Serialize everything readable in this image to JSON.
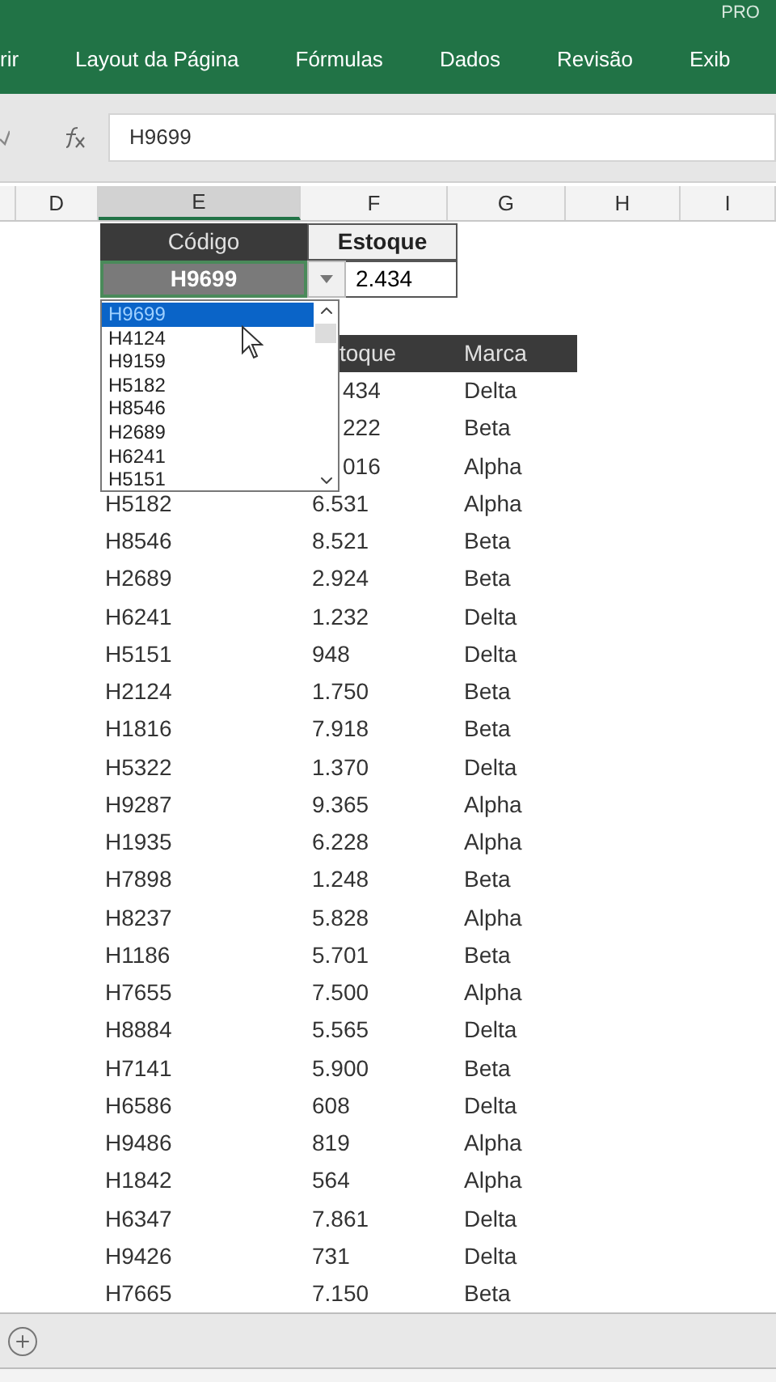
{
  "title": "PRO",
  "ribbon_tabs": [
    "rir",
    "Layout da Página",
    "Fórmulas",
    "Dados",
    "Revisão",
    "Exib"
  ],
  "formula_bar": {
    "value": "H9699"
  },
  "column_headers": [
    {
      "label": "D",
      "selected": false
    },
    {
      "label": "E",
      "selected": true
    },
    {
      "label": "F",
      "selected": false
    },
    {
      "label": "G",
      "selected": false
    },
    {
      "label": "H",
      "selected": false
    },
    {
      "label": "I",
      "selected": false
    }
  ],
  "lookup": {
    "code_header": "Código",
    "stock_header": "Estoque",
    "code": "H9699",
    "stock": "2.434"
  },
  "dropdown": {
    "items": [
      {
        "label": "H9699",
        "selected": true
      },
      {
        "label": "H4124",
        "selected": false
      },
      {
        "label": "H9159",
        "selected": false
      },
      {
        "label": "H5182",
        "selected": false
      },
      {
        "label": "H8546",
        "selected": false
      },
      {
        "label": "H2689",
        "selected": false
      },
      {
        "label": "H6241",
        "selected": false
      },
      {
        "label": "H5151",
        "selected": false
      }
    ]
  },
  "table": {
    "columns": [
      "toque",
      "Marca"
    ],
    "rows": [
      {
        "stock": "434",
        "brand": "Delta"
      },
      {
        "stock": "222",
        "brand": "Beta"
      },
      {
        "stock": "016",
        "brand": "Alpha"
      },
      {
        "code": "H5182",
        "stock": "6.531",
        "brand": "Alpha"
      },
      {
        "code": "H8546",
        "stock": "8.521",
        "brand": "Beta"
      },
      {
        "code": "H2689",
        "stock": "2.924",
        "brand": "Beta"
      },
      {
        "code": "H6241",
        "stock": "1.232",
        "brand": "Delta"
      },
      {
        "code": "H5151",
        "stock": "948",
        "brand": "Delta"
      },
      {
        "code": "H2124",
        "stock": "1.750",
        "brand": "Beta"
      },
      {
        "code": "H1816",
        "stock": "7.918",
        "brand": "Beta"
      },
      {
        "code": "H5322",
        "stock": "1.370",
        "brand": "Delta"
      },
      {
        "code": "H9287",
        "stock": "9.365",
        "brand": "Alpha"
      },
      {
        "code": "H1935",
        "stock": "6.228",
        "brand": "Alpha"
      },
      {
        "code": "H7898",
        "stock": "1.248",
        "brand": "Beta"
      },
      {
        "code": "H8237",
        "stock": "5.828",
        "brand": "Alpha"
      },
      {
        "code": "H1186",
        "stock": "5.701",
        "brand": "Beta"
      },
      {
        "code": "H7655",
        "stock": "7.500",
        "brand": "Alpha"
      },
      {
        "code": "H8884",
        "stock": "5.565",
        "brand": "Delta"
      },
      {
        "code": "H7141",
        "stock": "5.900",
        "brand": "Beta"
      },
      {
        "code": "H6586",
        "stock": "608",
        "brand": "Delta"
      },
      {
        "code": "H9486",
        "stock": "819",
        "brand": "Alpha"
      },
      {
        "code": "H1842",
        "stock": "564",
        "brand": "Alpha"
      },
      {
        "code": "H6347",
        "stock": "7.861",
        "brand": "Delta"
      },
      {
        "code": "H9426",
        "stock": "731",
        "brand": "Delta"
      },
      {
        "code": "H7665",
        "stock": "7.150",
        "brand": "Beta"
      }
    ]
  }
}
